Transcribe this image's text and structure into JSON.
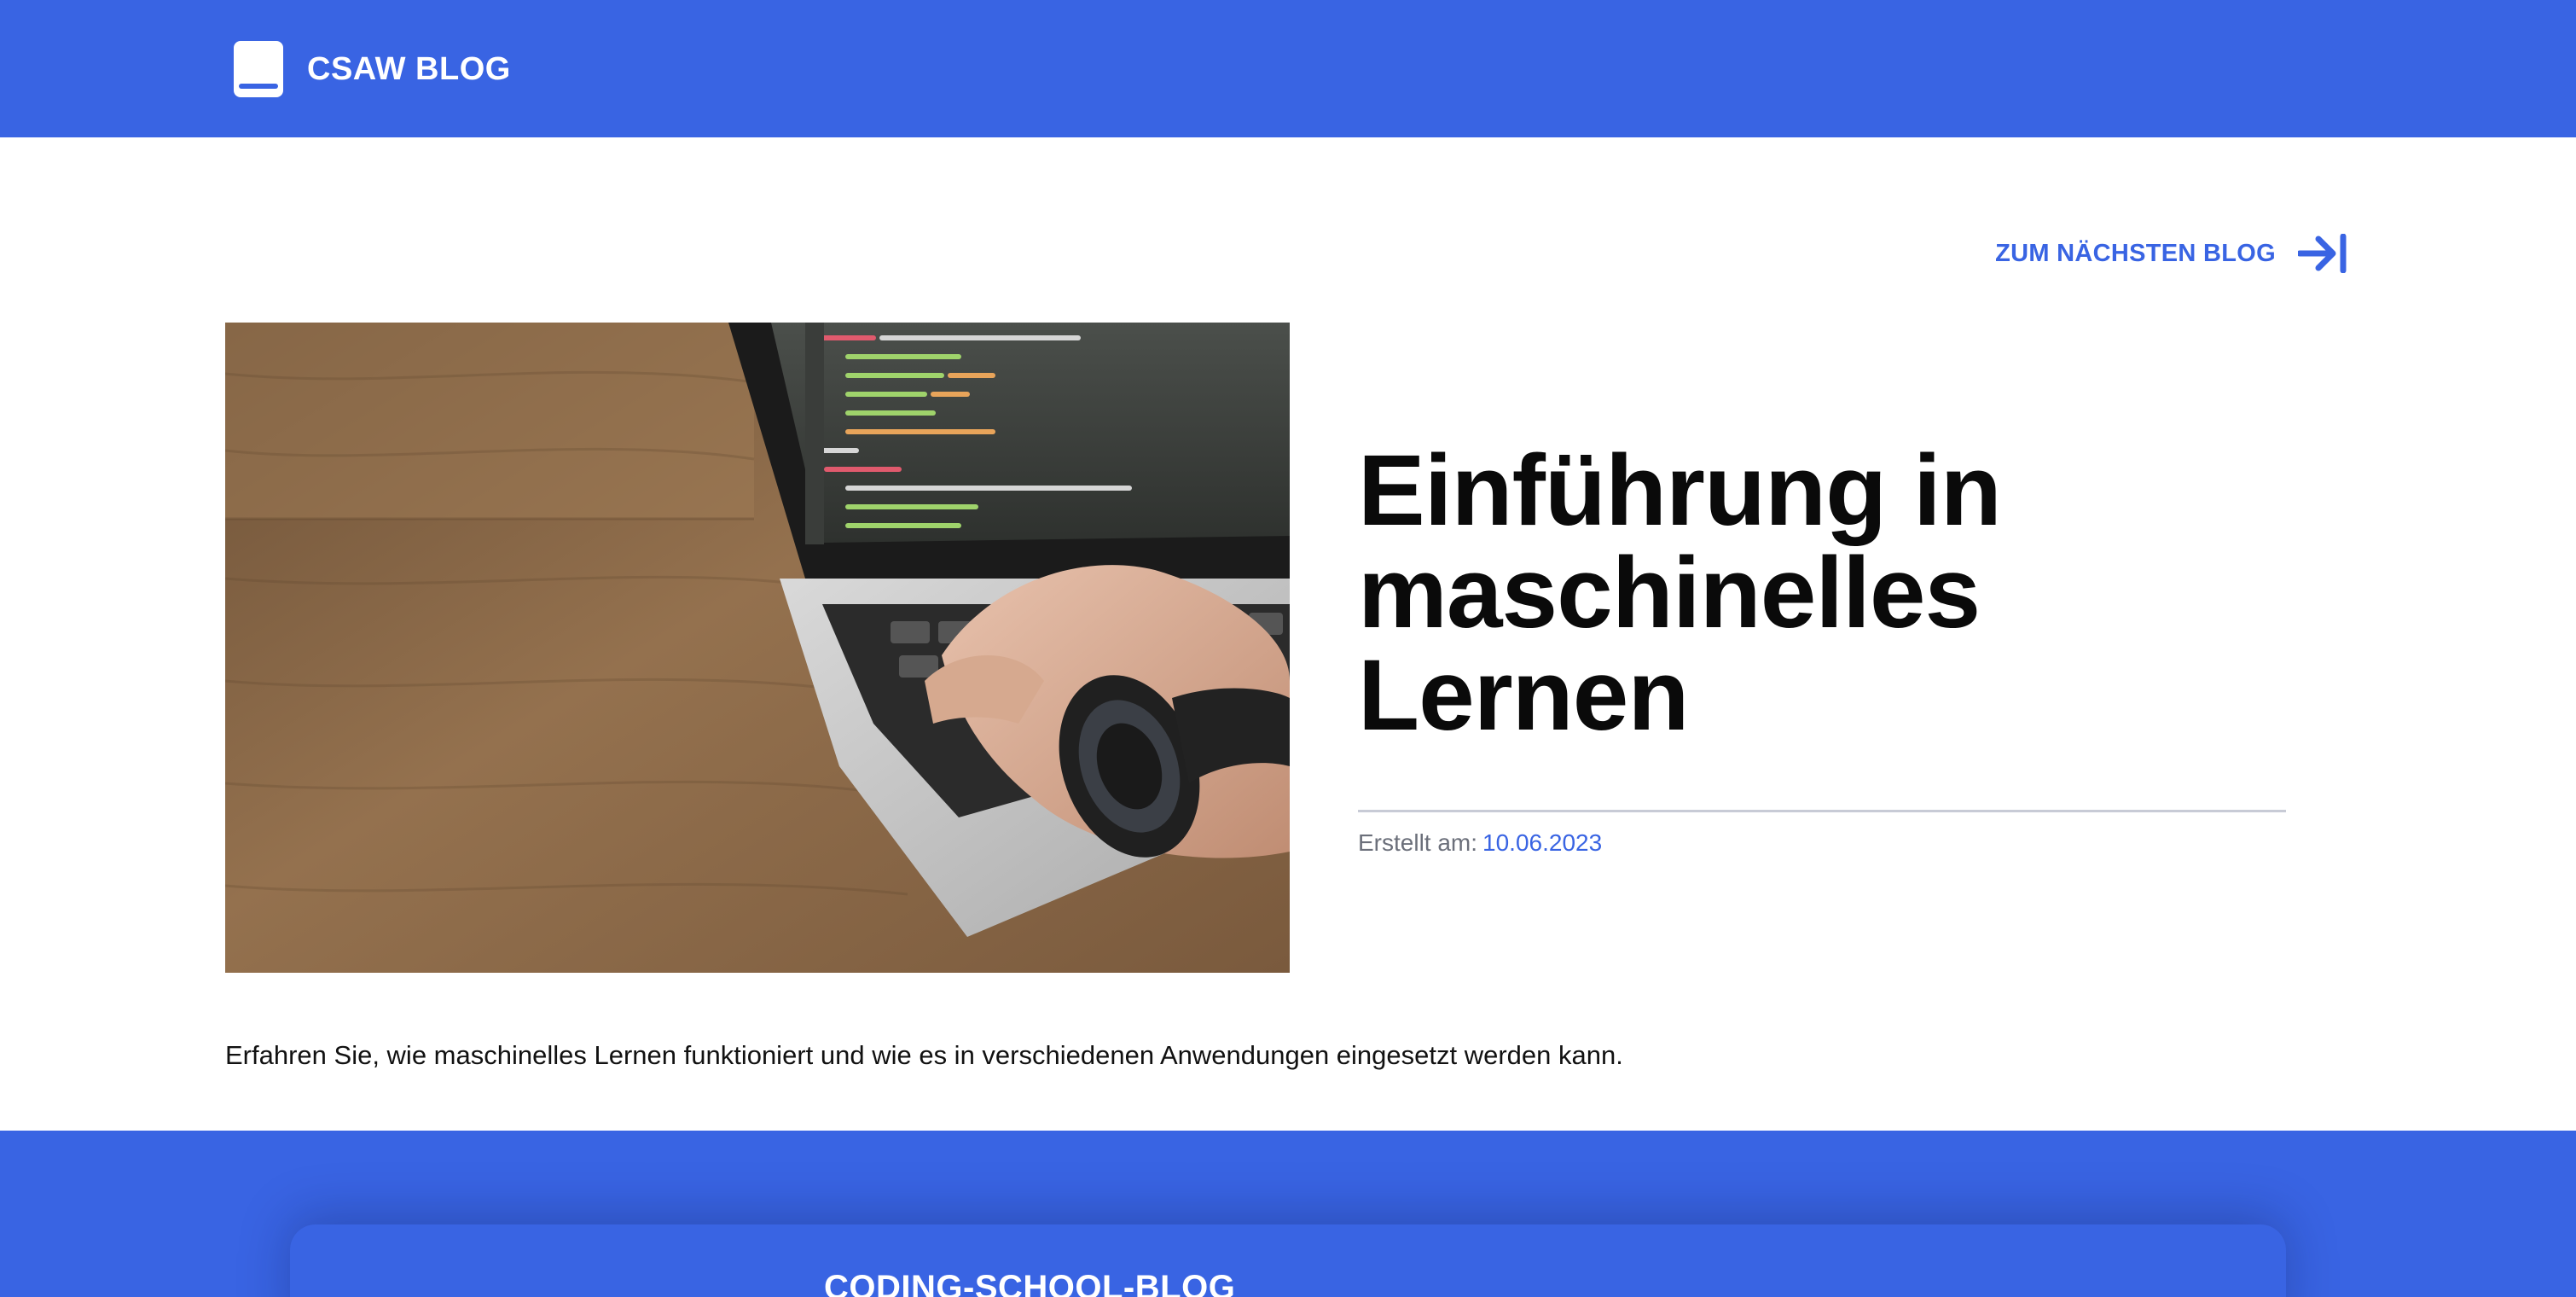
{
  "header": {
    "brand_name": "CSAW BLOG",
    "brand_icon": "book-icon",
    "background_color": "#3964e3"
  },
  "navigation": {
    "next_blog_label": "ZUM NÄCHSTEN BLOG",
    "next_blog_icon": "arrow-right-to-line-icon"
  },
  "post": {
    "title": "Einführung in maschinelles Lernen",
    "created_label": "Erstellt am:",
    "created_date": "10.06.2023",
    "description": "Erfahren Sie, wie maschinelles Lernen funktioniert und wie es in verschiedenen Anwendungen eingesetzt werden kann.",
    "image_subject": "laptop-with-code-on-wooden-desk"
  },
  "footer": {
    "title": "CODING-SCHOOL-BLOG"
  },
  "colors": {
    "accent": "#3964e3",
    "title_text": "#0a0a0a",
    "meta_text": "#6b6f7a",
    "divider": "#c8cbd6"
  }
}
